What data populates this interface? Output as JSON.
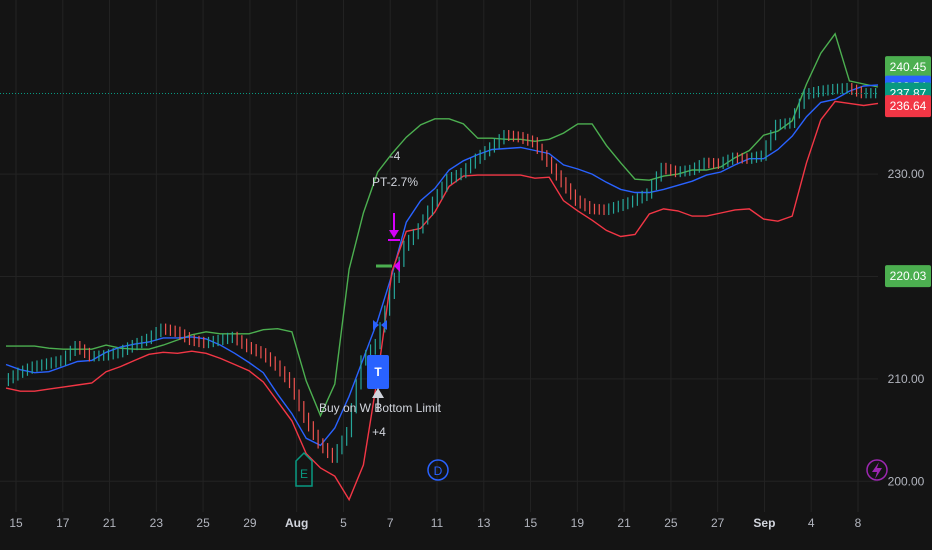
{
  "colors": {
    "background": "#141414",
    "grid": "#232323",
    "upper_band": "#4caf50",
    "middle_band": "#2962ff",
    "lower_band": "#f23645",
    "bull_candle": "#26a69a",
    "bear_candle": "#ef5350",
    "last_price": "#089981",
    "signal": "#d500f9",
    "earnings": "#089981",
    "dividend": "#2962ff",
    "split": "#9c27b0"
  },
  "chart_data": {
    "type": "line",
    "y_axis": {
      "range": [
        197,
        247
      ],
      "ticks": [
        200,
        210,
        220,
        230
      ]
    },
    "x_axis": {
      "tick_labels": [
        "15",
        "17",
        "21",
        "23",
        "25",
        "29",
        "Aug",
        "5",
        "7",
        "11",
        "13",
        "15",
        "19",
        "21",
        "25",
        "27",
        "Sep",
        "4",
        "8"
      ],
      "month_labels": [
        "Aug",
        "Sep"
      ],
      "n_bars": 62
    },
    "series": [
      {
        "key": "upper",
        "values": [
          213.2,
          213.2,
          213.2,
          213.0,
          212.9,
          212.9,
          212.9,
          213.3,
          213.0,
          212.9,
          212.9,
          213.3,
          213.8,
          214.3,
          214.6,
          214.4,
          214.4,
          214.4,
          214.8,
          214.9,
          214.6,
          209.8,
          206.4,
          209.5,
          220.7,
          226.2,
          230.2,
          232.0,
          233.6,
          234.8,
          235.4,
          235.4,
          234.9,
          233.5,
          233.5,
          233.4,
          233.4,
          233.2,
          233.4,
          234.0,
          234.9,
          234.9,
          232.8,
          231.1,
          229.5,
          229.4,
          229.8,
          230.0,
          230.4,
          230.4,
          230.7,
          231.6,
          232.3,
          233.8,
          234.2,
          235.2,
          238.8,
          241.8,
          243.7,
          239.1,
          238.8,
          238.5
        ]
      },
      {
        "key": "middle",
        "values": [
          211.4,
          210.9,
          210.6,
          210.7,
          211.2,
          211.7,
          211.8,
          212.6,
          213.1,
          213.4,
          213.6,
          214.0,
          214.0,
          214.1,
          213.9,
          213.3,
          212.5,
          211.6,
          210.6,
          208.5,
          206.6,
          204.2,
          203.5,
          205.2,
          208.3,
          212.0,
          215.7,
          220.2,
          225.3,
          227.4,
          228.6,
          230.4,
          231.3,
          231.9,
          232.4,
          232.5,
          232.6,
          232.3,
          232.0,
          230.9,
          230.5,
          230.0,
          229.2,
          228.5,
          228.2,
          228.2,
          228.5,
          228.9,
          229.3,
          229.9,
          230.2,
          230.9,
          231.5,
          231.5,
          232.4,
          233.7,
          235.6,
          237.0,
          237.3,
          238.1,
          238.6,
          238.7
        ]
      },
      {
        "key": "lower",
        "values": [
          209.1,
          208.8,
          208.8,
          209.0,
          209.2,
          209.4,
          209.6,
          210.7,
          211.2,
          211.8,
          212.4,
          212.6,
          212.5,
          212.7,
          212.5,
          212.0,
          211.4,
          210.8,
          209.7,
          207.8,
          205.9,
          202.7,
          201.3,
          200.5,
          198.2,
          201.6,
          210.3,
          220.5,
          224.4,
          224.7,
          226.3,
          228.8,
          229.8,
          229.9,
          229.9,
          229.9,
          229.9,
          229.6,
          229.7,
          227.4,
          226.4,
          225.5,
          224.5,
          223.9,
          224.1,
          226.1,
          226.6,
          226.4,
          225.9,
          225.9,
          226.2,
          226.5,
          226.6,
          225.6,
          225.4,
          225.9,
          231.1,
          235.3,
          237.1,
          236.9,
          236.7,
          236.9
        ]
      },
      {
        "key": "close",
        "values": [
          209.8,
          210.6,
          211.2,
          211.5,
          211.8,
          213.2,
          212.2,
          212.3,
          212.6,
          213.3,
          213.9,
          214.9,
          214.6,
          213.8,
          213.5,
          213.8,
          214.1,
          213.1,
          212.5,
          211.3,
          209.6,
          206.2,
          203.7,
          202.3,
          204.8,
          211.8,
          213.4,
          218.3,
          223.0,
          224.7,
          227.3,
          229.5,
          230.1,
          231.5,
          232.6,
          233.8,
          233.6,
          233.1,
          231.2,
          229.2,
          227.4,
          226.6,
          226.5,
          226.9,
          227.4,
          228.1,
          230.6,
          230.2,
          230.4,
          231.1,
          231.0,
          231.6,
          231.5,
          231.8,
          234.8,
          235.0,
          237.8,
          238.1,
          238.3,
          238.4,
          237.9,
          237.9
        ]
      }
    ],
    "price_labels": [
      {
        "text": "240.45",
        "value": 240.45,
        "color": "#4caf50"
      },
      {
        "text": "238.54",
        "value": 238.54,
        "color": "#2962ff"
      },
      {
        "text": "237.87",
        "value": 237.87,
        "color": "#089981"
      },
      {
        "text": "236.64",
        "value": 236.64,
        "color": "#f23645"
      },
      {
        "text": "220.03",
        "value": 220.03,
        "color": "#4caf50"
      }
    ],
    "annotations": {
      "sell_qty": "-4",
      "profit_target": "PT-2.7%",
      "buy_text": "Buy on W Bottom Limit",
      "buy_qty": "+4",
      "buy_marker": "T",
      "earnings_marker": "E",
      "dividend_marker": "D"
    },
    "icons": {
      "split": "lightning-bolt-icon",
      "entry": "up-arrow-icon",
      "exit": "down-arrow-icon"
    }
  }
}
